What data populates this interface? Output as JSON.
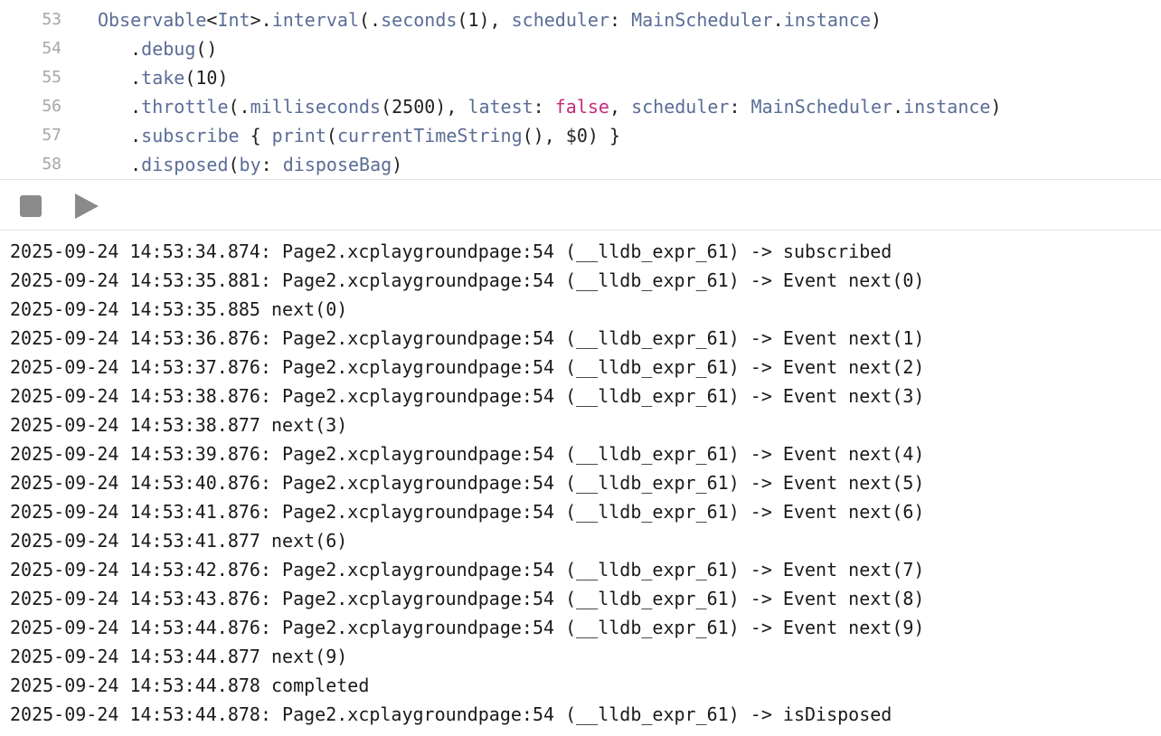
{
  "editor": {
    "lines": [
      {
        "num": "53",
        "tokens": [
          {
            "t": "Observable",
            "c": "type"
          },
          {
            "t": "<",
            "c": "p"
          },
          {
            "t": "Int",
            "c": "type"
          },
          {
            "t": ">.",
            "c": "p"
          },
          {
            "t": "interval",
            "c": "type"
          },
          {
            "t": "(.",
            "c": "p"
          },
          {
            "t": "seconds",
            "c": "type"
          },
          {
            "t": "(1), ",
            "c": "p"
          },
          {
            "t": "scheduler",
            "c": "type"
          },
          {
            "t": ": ",
            "c": "p"
          },
          {
            "t": "MainScheduler",
            "c": "type"
          },
          {
            "t": ".",
            "c": "p"
          },
          {
            "t": "instance",
            "c": "type"
          },
          {
            "t": ")",
            "c": "p"
          }
        ]
      },
      {
        "num": "54",
        "tokens": [
          {
            "t": "   .",
            "c": "p"
          },
          {
            "t": "debug",
            "c": "type"
          },
          {
            "t": "()",
            "c": "p"
          }
        ]
      },
      {
        "num": "55",
        "tokens": [
          {
            "t": "   .",
            "c": "p"
          },
          {
            "t": "take",
            "c": "type"
          },
          {
            "t": "(10)",
            "c": "p"
          }
        ]
      },
      {
        "num": "56",
        "tokens": [
          {
            "t": "   .",
            "c": "p"
          },
          {
            "t": "throttle",
            "c": "type"
          },
          {
            "t": "(.",
            "c": "p"
          },
          {
            "t": "milliseconds",
            "c": "type"
          },
          {
            "t": "(2500), ",
            "c": "p"
          },
          {
            "t": "latest",
            "c": "type"
          },
          {
            "t": ": ",
            "c": "p"
          },
          {
            "t": "false",
            "c": "kw"
          },
          {
            "t": ", ",
            "c": "p"
          },
          {
            "t": "scheduler",
            "c": "type"
          },
          {
            "t": ": ",
            "c": "p"
          },
          {
            "t": "MainScheduler",
            "c": "type"
          },
          {
            "t": ".",
            "c": "p"
          },
          {
            "t": "instance",
            "c": "type"
          },
          {
            "t": ")",
            "c": "p"
          }
        ]
      },
      {
        "num": "57",
        "tokens": [
          {
            "t": "   .",
            "c": "p"
          },
          {
            "t": "subscribe",
            "c": "type"
          },
          {
            "t": " { ",
            "c": "p"
          },
          {
            "t": "print",
            "c": "type"
          },
          {
            "t": "(",
            "c": "p"
          },
          {
            "t": "currentTimeString",
            "c": "type"
          },
          {
            "t": "(), $0) }",
            "c": "p"
          }
        ]
      },
      {
        "num": "58",
        "tokens": [
          {
            "t": "   .",
            "c": "p"
          },
          {
            "t": "disposed",
            "c": "type"
          },
          {
            "t": "(",
            "c": "p"
          },
          {
            "t": "by",
            "c": "type"
          },
          {
            "t": ": ",
            "c": "p"
          },
          {
            "t": "disposeBag",
            "c": "type"
          },
          {
            "t": ")",
            "c": "p"
          }
        ]
      }
    ]
  },
  "toolbar": {
    "stop_icon": "stop-icon",
    "play_icon": "play-icon"
  },
  "console": {
    "lines": [
      "2025-09-24 14:53:34.874: Page2.xcplaygroundpage:54 (__lldb_expr_61) -> subscribed",
      "2025-09-24 14:53:35.881: Page2.xcplaygroundpage:54 (__lldb_expr_61) -> Event next(0)",
      "2025-09-24 14:53:35.885 next(0)",
      "2025-09-24 14:53:36.876: Page2.xcplaygroundpage:54 (__lldb_expr_61) -> Event next(1)",
      "2025-09-24 14:53:37.876: Page2.xcplaygroundpage:54 (__lldb_expr_61) -> Event next(2)",
      "2025-09-24 14:53:38.876: Page2.xcplaygroundpage:54 (__lldb_expr_61) -> Event next(3)",
      "2025-09-24 14:53:38.877 next(3)",
      "2025-09-24 14:53:39.876: Page2.xcplaygroundpage:54 (__lldb_expr_61) -> Event next(4)",
      "2025-09-24 14:53:40.876: Page2.xcplaygroundpage:54 (__lldb_expr_61) -> Event next(5)",
      "2025-09-24 14:53:41.876: Page2.xcplaygroundpage:54 (__lldb_expr_61) -> Event next(6)",
      "2025-09-24 14:53:41.877 next(6)",
      "2025-09-24 14:53:42.876: Page2.xcplaygroundpage:54 (__lldb_expr_61) -> Event next(7)",
      "2025-09-24 14:53:43.876: Page2.xcplaygroundpage:54 (__lldb_expr_61) -> Event next(8)",
      "2025-09-24 14:53:44.876: Page2.xcplaygroundpage:54 (__lldb_expr_61) -> Event next(9)",
      "2025-09-24 14:53:44.877 next(9)",
      "2025-09-24 14:53:44.878 completed",
      "2025-09-24 14:53:44.878: Page2.xcplaygroundpage:54 (__lldb_expr_61) -> isDisposed"
    ]
  }
}
